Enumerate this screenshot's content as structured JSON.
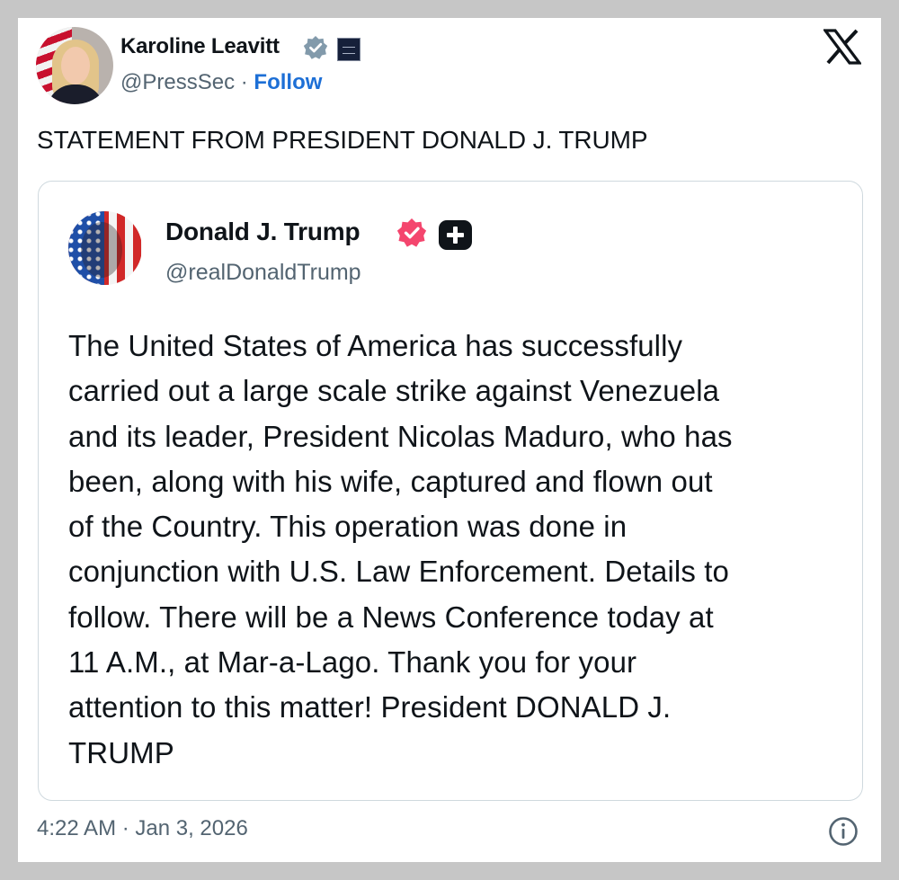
{
  "post": {
    "author_name": "Karoline Leavitt",
    "author_handle": "@PressSec",
    "separator": " · ",
    "follow_label": "Follow",
    "text": "STATEMENT FROM PRESIDENT DONALD J. TRUMP",
    "timestamp": "4:22 AM · Jan 3, 2026",
    "icons": {
      "avatar": "profile-photo",
      "verified": "verified-badge-gray",
      "affiliation": "affiliate-badge",
      "platform": "x-logo",
      "info": "info-icon"
    },
    "colors": {
      "follow": "#1d6fd6",
      "secondary_text": "#536471",
      "verified_gray": "#829aab"
    }
  },
  "quoted_post": {
    "author_name": "Donald J. Trump",
    "author_handle": "@realDonaldTrump",
    "body_lines": [
      "The United States of America has successfully",
      "carried out a large scale strike against Venezuela",
      "and its leader, President Nicolas Maduro, who has",
      "been, along with his wife, captured and flown out",
      "of the Country. This operation was done in",
      "conjunction with U.S. Law Enforcement. Details to",
      "follow. There will be a News Conference today at",
      "11 A.M., at Mar-a-Lago. Thank you for your",
      "attention to this matter! President DONALD J.",
      "TRUMP"
    ],
    "icons": {
      "avatar": "profile-photo",
      "verified": "verified-badge-pink",
      "platform_badge": "plus-badge"
    },
    "colors": {
      "verified_pink": "#f4466e"
    }
  }
}
